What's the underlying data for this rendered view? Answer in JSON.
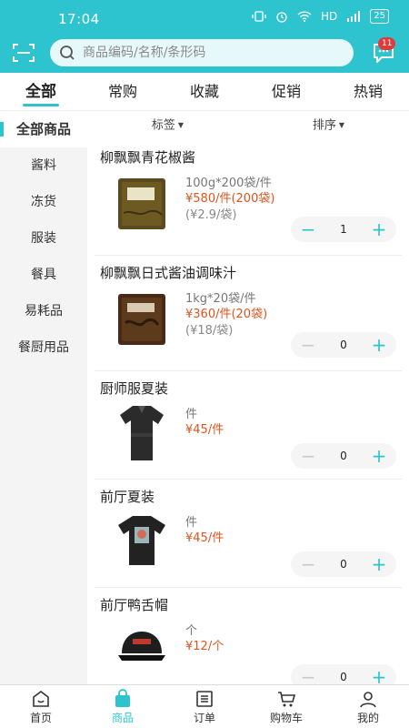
{
  "status_bar": {
    "time": "17:04",
    "network": "HD",
    "battery": "25"
  },
  "search": {
    "placeholder": "商品编码/名称/条形码"
  },
  "messages": {
    "badge": "11"
  },
  "tabs": [
    {
      "label": "全部",
      "active": true
    },
    {
      "label": "常购",
      "active": false
    },
    {
      "label": "收藏",
      "active": false
    },
    {
      "label": "促销",
      "active": false
    },
    {
      "label": "热销",
      "active": false
    }
  ],
  "sidebar": {
    "items": [
      {
        "label": "全部商品",
        "active": true
      },
      {
        "label": "酱料"
      },
      {
        "label": "冻货"
      },
      {
        "label": "服装"
      },
      {
        "label": "餐具"
      },
      {
        "label": "易耗品"
      },
      {
        "label": "餐厨用品"
      }
    ]
  },
  "filters": {
    "tag_label": "标签",
    "sort_label": "排序"
  },
  "products": [
    {
      "name": "柳飘飘青花椒酱",
      "spec": "100g*200袋/件",
      "price": "¥580/件(200袋)",
      "unit_price": "(¥2.9/袋)",
      "qty": "1",
      "image_icon": "sauce-bag-icon"
    },
    {
      "name": "柳飘飘日式酱油调味汁",
      "spec": "1kg*20袋/件",
      "price": "¥360/件(20袋)",
      "unit_price": "(¥18/袋)",
      "qty": "0",
      "image_icon": "sauce-bag-icon"
    },
    {
      "name": "厨师服夏装",
      "spec": "件",
      "price": "¥45/件",
      "unit_price": "",
      "qty": "0",
      "image_icon": "chef-uniform-icon"
    },
    {
      "name": "前厅夏装",
      "spec": "件",
      "price": "¥45/件",
      "unit_price": "",
      "qty": "0",
      "image_icon": "tshirt-icon"
    },
    {
      "name": "前厅鸭舌帽",
      "spec": "个",
      "price": "¥12/个",
      "unit_price": "",
      "qty": "0",
      "image_icon": "cap-icon"
    }
  ],
  "bottom_nav": [
    {
      "label": "首页",
      "icon": "home-icon",
      "active": false
    },
    {
      "label": "商品",
      "icon": "bag-icon",
      "active": true
    },
    {
      "label": "订单",
      "icon": "order-icon",
      "active": false
    },
    {
      "label": "购物车",
      "icon": "cart-icon",
      "active": false
    },
    {
      "label": "我的",
      "icon": "user-icon",
      "active": false
    }
  ],
  "colors": {
    "primary": "#2ec4cf",
    "price": "#e0541e",
    "badge": "#e03a3a"
  }
}
